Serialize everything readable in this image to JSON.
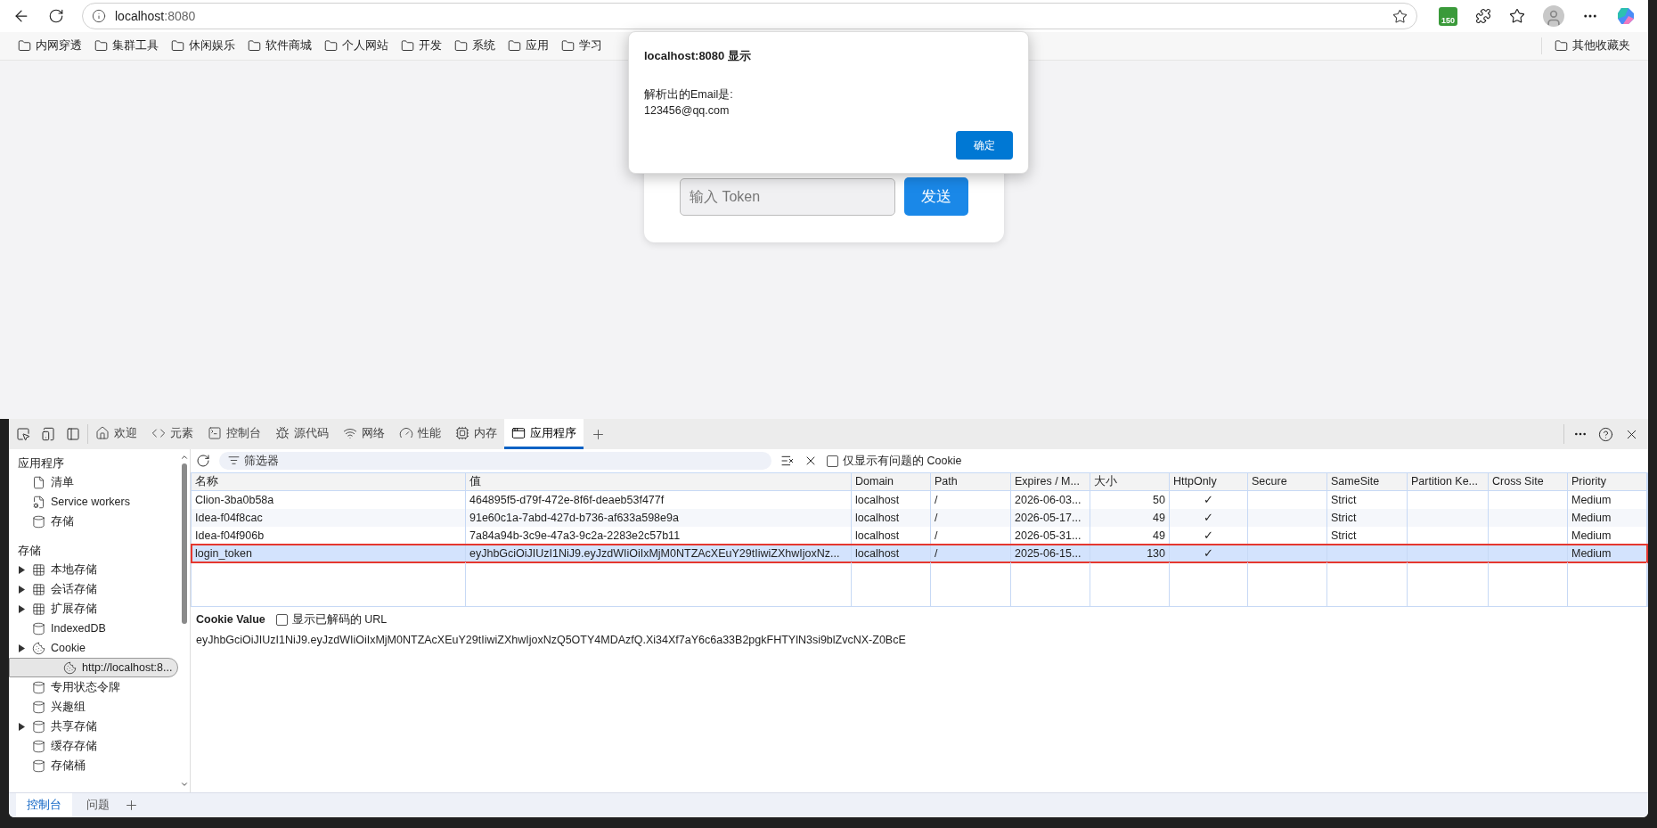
{
  "address_bar": {
    "host": "localhost",
    "port": ":8080"
  },
  "extension_badge": "150",
  "bookmarks": [
    "内网穿透",
    "集群工具",
    "休闲娱乐",
    "软件商城",
    "个人网站",
    "开发",
    "系统",
    "应用",
    "学习"
  ],
  "other_bookmarks": "其他收藏夹",
  "dialog": {
    "title": "localhost:8080 显示",
    "message_lines": [
      "解析出的Email是:",
      "123456@qq.com"
    ],
    "button": "确定"
  },
  "token_form": {
    "placeholder": "输入 Token",
    "button": "发送"
  },
  "devtools": {
    "tabs": [
      {
        "label": "欢迎",
        "kind": "home",
        "selected": false
      },
      {
        "label": "元素",
        "kind": "code",
        "selected": false
      },
      {
        "label": "控制台",
        "kind": "console",
        "selected": false
      },
      {
        "label": "源代码",
        "kind": "bug",
        "selected": false
      },
      {
        "label": "网络",
        "kind": "wifi",
        "selected": false
      },
      {
        "label": "性能",
        "kind": "gauge",
        "selected": false
      },
      {
        "label": "内存",
        "kind": "chip",
        "selected": false
      },
      {
        "label": "应用程序",
        "kind": "app",
        "selected": true
      }
    ],
    "sidebar": [
      {
        "heading": "应用程序",
        "items": [
          {
            "label": "清单",
            "kind": "file",
            "arrow": false,
            "selected": false
          },
          {
            "label": "Service workers",
            "kind": "worker",
            "arrow": false,
            "selected": false
          },
          {
            "label": "存储",
            "kind": "db",
            "arrow": false,
            "selected": false
          }
        ]
      },
      {
        "heading": "存储",
        "items": [
          {
            "label": "本地存储",
            "kind": "table",
            "arrow": true,
            "selected": false
          },
          {
            "label": "会话存储",
            "kind": "table",
            "arrow": true,
            "selected": false
          },
          {
            "label": "扩展存储",
            "kind": "table",
            "arrow": true,
            "selected": false
          },
          {
            "label": "IndexedDB",
            "kind": "db",
            "arrow": false,
            "selected": false
          },
          {
            "label": "Cookie",
            "kind": "cookie",
            "arrow": true,
            "selected": false,
            "children": [
              {
                "label": "http://localhost:8...",
                "kind": "cookie",
                "arrow": false,
                "selected": true
              }
            ]
          },
          {
            "label": "专用状态令牌",
            "kind": "db",
            "arrow": false,
            "selected": false
          },
          {
            "label": "兴趣组",
            "kind": "db",
            "arrow": false,
            "selected": false
          },
          {
            "label": "共享存储",
            "kind": "db",
            "arrow": true,
            "selected": false
          },
          {
            "label": "缓存存储",
            "kind": "db",
            "arrow": false,
            "selected": false
          },
          {
            "label": "存储桶",
            "kind": "db",
            "arrow": false,
            "selected": false
          }
        ]
      }
    ],
    "filter": {
      "placeholder": "筛选器",
      "only_issues": {
        "label": "仅显示有问题的 Cookie",
        "checked": false
      }
    },
    "table": {
      "columns": [
        "名称",
        "值",
        "Domain",
        "Path",
        "Expires / M...",
        "大小",
        "HttpOnly",
        "Secure",
        "SameSite",
        "Partition Ke...",
        "Cross Site",
        "Priority"
      ],
      "rows": [
        {
          "name": "Clion-3ba0b58a",
          "value": "464895f5-d79f-472e-8f6f-deaeb53f477f",
          "domain": "localhost",
          "path": "/",
          "expires": "2026-06-03...",
          "size": "50",
          "http_only": "✓",
          "same_site": "Strict",
          "priority": "Medium",
          "selected": false
        },
        {
          "name": "Idea-f04f8cac",
          "value": "91e60c1a-7abd-427d-b736-af633a598e9a",
          "domain": "localhost",
          "path": "/",
          "expires": "2026-05-17...",
          "size": "49",
          "http_only": "✓",
          "same_site": "Strict",
          "priority": "Medium",
          "selected": false
        },
        {
          "name": "Idea-f04f906b",
          "value": "7a84a94b-3c9e-47a3-9c2a-2283e2c57b11",
          "domain": "localhost",
          "path": "/",
          "expires": "2026-05-31...",
          "size": "49",
          "http_only": "✓",
          "same_site": "Strict",
          "priority": "Medium",
          "selected": false
        },
        {
          "name": "login_token",
          "value": "eyJhbGciOiJIUzI1NiJ9.eyJzdWIiOiIxMjM0NTZAcXEuY29tIiwiZXhwIjoxNz...",
          "domain": "localhost",
          "path": "/",
          "expires": "2025-06-15...",
          "size": "130",
          "http_only": "✓",
          "priority": "Medium",
          "selected": true
        }
      ]
    },
    "cookie_value": {
      "title": "Cookie Value",
      "decode": {
        "label": "显示已解码的 URL",
        "checked": false
      },
      "value": "eyJhbGciOiJIUzI1NiJ9.eyJzdWIiOiIxMjM0NTZAcXEuY29tIiwiZXhwIjoxNzQ5OTY4MDAzfQ.Xi34Xf7aY6c6a33B2pgkFHTYlN3si9blZvcNX-Z0BcE"
    },
    "drawer_tabs": [
      {
        "label": "控制台",
        "selected": true
      },
      {
        "label": "问题",
        "selected": false
      }
    ]
  }
}
